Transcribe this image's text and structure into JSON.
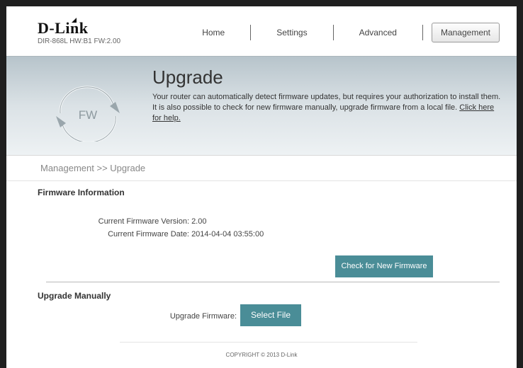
{
  "header": {
    "brand": "D-Link",
    "device_info": "DIR-868L   HW:B1   FW:2.00",
    "nav": [
      {
        "label": "Home"
      },
      {
        "label": "Settings"
      },
      {
        "label": "Advanced"
      },
      {
        "label": "Management"
      }
    ],
    "active_nav": "Management"
  },
  "banner": {
    "icon_label": "FW",
    "title": "Upgrade",
    "description": "Your router can automatically detect firmware updates, but requires your authorization to install them. It is also possible to check for new firmware manually, upgrade firmware from a local file.",
    "help_link": "Click here for help."
  },
  "breadcrumb": "Management >> Upgrade",
  "firmware_info": {
    "title": "Firmware Information",
    "version_label": "Current Firmware Version:",
    "version_value": "2.00",
    "date_label": "Current Firmware Date:",
    "date_value": "2014-04-04 03:55:00",
    "check_button": "Check for New Firmware"
  },
  "upgrade_manually": {
    "title": "Upgrade Manually",
    "field_label": "Upgrade Firmware:",
    "select_button": "Select File"
  },
  "footer": "COPYRIGHT © 2013 D-Link",
  "colors": {
    "button": "#4a8d97",
    "banner_top": "#b7c4cb",
    "banner_bottom": "#eef2f4"
  }
}
